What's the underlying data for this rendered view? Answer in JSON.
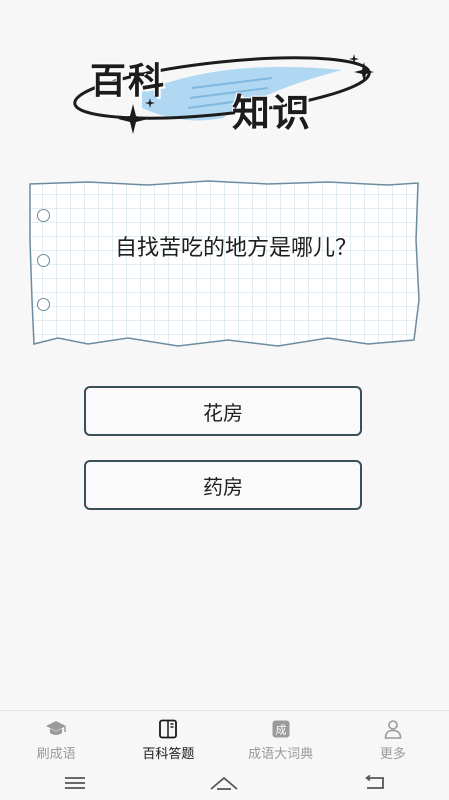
{
  "banner": {
    "line1": "百科",
    "line2": "知识"
  },
  "question": {
    "text": "自找苦吃的地方是哪儿？"
  },
  "options": [
    {
      "label": "花房"
    },
    {
      "label": "药房"
    }
  ],
  "tabs": [
    {
      "label": "刷成语",
      "icon": "graduation-cap-icon",
      "active": false
    },
    {
      "label": "百科答题",
      "icon": "book-icon",
      "active": true
    },
    {
      "label": "成语大词典",
      "icon": "dictionary-icon",
      "active": false
    },
    {
      "label": "更多",
      "icon": "person-icon",
      "active": false
    }
  ],
  "system_nav": [
    "menu-icon",
    "home-icon",
    "back-icon"
  ],
  "colors": {
    "background": "#f7f7f7",
    "grid": "#c9dbe6",
    "button_border": "#3a4f5a",
    "banner_accent": "#a9d4f2"
  }
}
